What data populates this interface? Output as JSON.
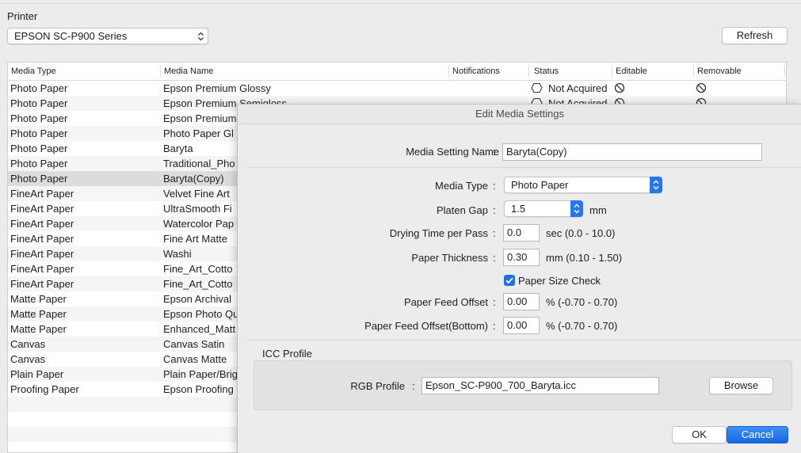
{
  "printer": {
    "label": "Printer",
    "selected": "EPSON SC-P900 Series",
    "refresh_label": "Refresh"
  },
  "table": {
    "columns": [
      "Media Type",
      "Media Name",
      "Notifications",
      "Status",
      "Editable",
      "Removable"
    ],
    "rows": [
      {
        "type": "Photo Paper",
        "name": "Epson Premium Glossy",
        "status": "Not Acquired"
      },
      {
        "type": "Photo Paper",
        "name": "Epson Premium Semigloss",
        "status": "Not Acquired"
      },
      {
        "type": "Photo Paper",
        "name": "Epson Premium",
        "status": ""
      },
      {
        "type": "Photo Paper",
        "name": "Photo Paper Gl",
        "status": ""
      },
      {
        "type": "Photo Paper",
        "name": "Baryta",
        "status": ""
      },
      {
        "type": "Photo Paper",
        "name": "Traditional_Pho",
        "status": ""
      },
      {
        "type": "Photo Paper",
        "name": "Baryta(Copy)",
        "status": ""
      },
      {
        "type": "FineArt Paper",
        "name": "Velvet Fine Art",
        "status": ""
      },
      {
        "type": "FineArt Paper",
        "name": "UltraSmooth Fi",
        "status": ""
      },
      {
        "type": "FineArt Paper",
        "name": "Watercolor Pap",
        "status": ""
      },
      {
        "type": "FineArt Paper",
        "name": "Fine Art Matte",
        "status": ""
      },
      {
        "type": "FineArt Paper",
        "name": "Washi",
        "status": ""
      },
      {
        "type": "FineArt Paper",
        "name": "Fine_Art_Cotto",
        "status": ""
      },
      {
        "type": "FineArt Paper",
        "name": "Fine_Art_Cotto",
        "status": ""
      },
      {
        "type": "Matte Paper",
        "name": "Epson Archival",
        "status": ""
      },
      {
        "type": "Matte Paper",
        "name": "Epson Photo Qu",
        "status": ""
      },
      {
        "type": "Matte Paper",
        "name": "Enhanced_Matt",
        "status": ""
      },
      {
        "type": "Canvas",
        "name": "Canvas Satin",
        "status": ""
      },
      {
        "type": "Canvas",
        "name": "Canvas Matte",
        "status": ""
      },
      {
        "type": "Plain Paper",
        "name": "Plain Paper/Brig",
        "status": ""
      },
      {
        "type": "Proofing Paper",
        "name": "Epson Proofing",
        "status": ""
      }
    ]
  },
  "dialog": {
    "title": "Edit Media Settings",
    "media_setting_name_label": "Media Setting Name",
    "media_setting_name_value": "Baryta(Copy)",
    "media_type_label": "Media Type",
    "media_type_value": "Photo Paper",
    "platen_gap_label": "Platen Gap",
    "platen_gap_value": "1.5",
    "platen_gap_unit": "mm",
    "drying_time_label": "Drying Time per Pass",
    "drying_time_value": "0.0",
    "drying_time_unit": "sec (0.0 - 10.0)",
    "paper_thickness_label": "Paper Thickness",
    "paper_thickness_value": "0.30",
    "paper_thickness_unit": "mm (0.10 - 1.50)",
    "paper_size_check_label": "Paper Size Check",
    "paper_size_check_checked": true,
    "feed_offset_label": "Paper Feed Offset",
    "feed_offset_value": "0.00",
    "feed_offset_unit": "% (-0.70 - 0.70)",
    "feed_offset_bottom_label": "Paper Feed Offset(Bottom)",
    "feed_offset_bottom_value": "0.00",
    "feed_offset_bottom_unit": "% (-0.70 - 0.70)",
    "icc_group_label": "ICC Profile",
    "rgb_profile_label": "RGB Profile",
    "rgb_profile_value": "Epson_SC-P900_700_Baryta.icc",
    "browse_label": "Browse",
    "ok_label": "OK",
    "cancel_label": "Cancel",
    "colon": ":"
  },
  "colors": {
    "accent": "#1a72e8",
    "selected_row": "#dcdcdc"
  }
}
